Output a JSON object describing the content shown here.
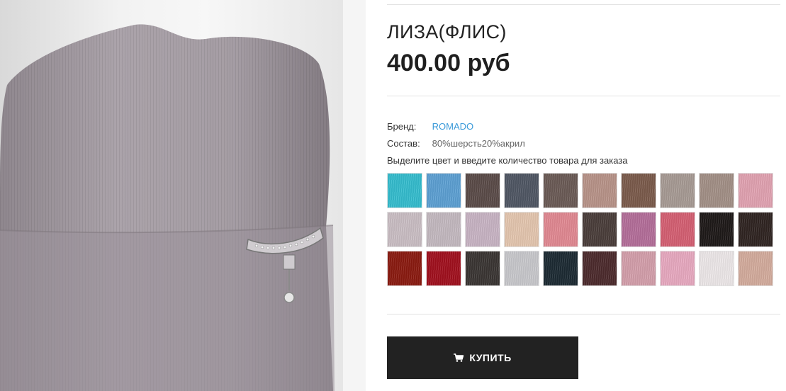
{
  "product": {
    "title": "ЛИЗА(ФЛИС)",
    "price": "400.00 руб",
    "brand_label": "Бренд:",
    "brand_value": "ROMADO",
    "composition_label": "Состав:",
    "composition_value": "80%шерсть20%акрил",
    "color_hint": "Выделите цвет и введите количество товара для заказа"
  },
  "colors": {
    "link": "#3a9ad9",
    "button_bg": "#222222",
    "hat": "#a79fa6"
  },
  "swatches": [
    "#34bccd",
    "#5c9fd2",
    "#5a4b48",
    "#4f5663",
    "#6a5a55",
    "#b79288",
    "#7a5a4b",
    "#a69a93",
    "#a28f86",
    "#e0a1b0",
    "#c9bdc3",
    "#c3b8bf",
    "#c7b3c3",
    "#e3c5ae",
    "#e08891",
    "#4a3d3a",
    "#b36d99",
    "#d45f72",
    "#1e1918",
    "#2f2421",
    "#8a1a10",
    "#a0101e",
    "#3a3533",
    "#c7c7cb",
    "#1c2a33",
    "#4c2a2c",
    "#d39eaa",
    "#e7a8bf",
    "#ece7e8",
    "#d3ab9c"
  ],
  "buy_button": {
    "label": "КУПИТЬ",
    "icon": "shopping-cart-icon"
  }
}
